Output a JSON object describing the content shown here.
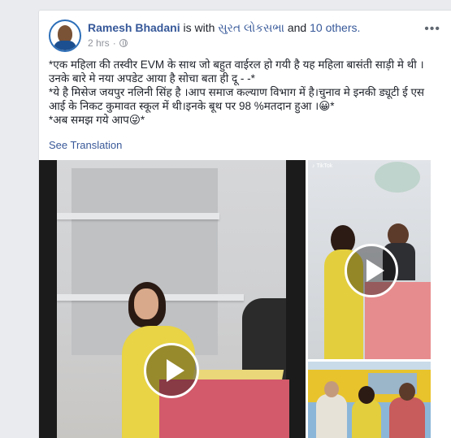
{
  "post": {
    "author": "Ramesh Bhadani",
    "with_text": " is with ",
    "with_link": "સુરત લોકસભા",
    "and_text": " and ",
    "others_link": "10 others.",
    "time": "2 hrs",
    "privacy_separator": "·",
    "more_icon": "•••",
    "text_lines": [
      "*एक महिला की तस्वीर EVM के साथ जो बहुत वाईरल हो गयी है यह महिला बासंती साड़ी मे थी । उनके बारे मे नया अपडेट आया है सोचा बता ही दू - -*",
      "*ये है मिसेज जयपुर नलिनी सिंह है ।आप समाज कल्याण विभाग में है।चुनाव मे इनकी ड्यूटी ई एस आई के निकट कुमावत स्कूल में थी।इनके बूथ पर 98 %मतदान हुआ ।😀*",
      "*अब समझ गये आप😜*"
    ],
    "see_translation": "See Translation",
    "tiktok_watermark": "♪ TikTok"
  }
}
